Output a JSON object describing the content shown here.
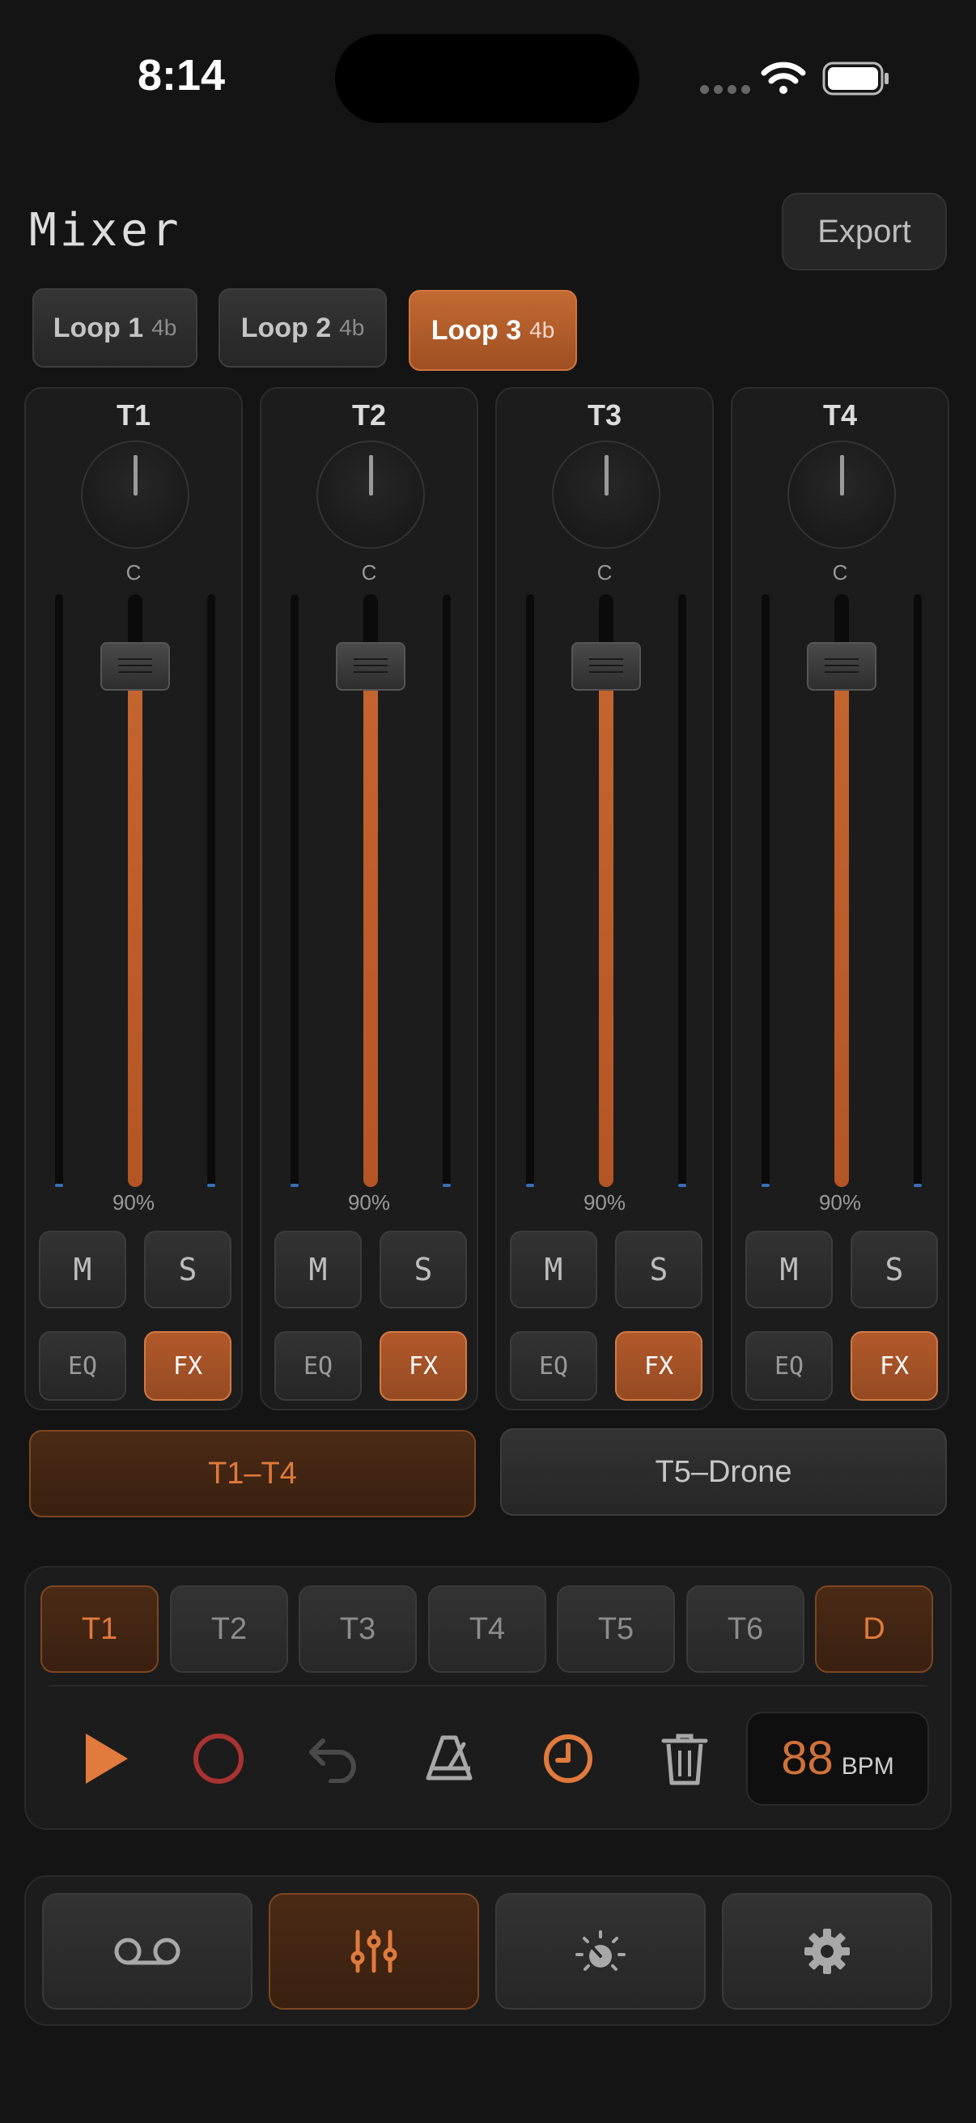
{
  "status": {
    "time": "8:14"
  },
  "header": {
    "title": "Mixer",
    "export_label": "Export"
  },
  "loops": [
    {
      "label": "Loop 1",
      "beats": "4b",
      "active": false
    },
    {
      "label": "Loop 2",
      "beats": "4b",
      "active": false
    },
    {
      "label": "Loop 3",
      "beats": "4b",
      "active": true
    }
  ],
  "channels": [
    {
      "name": "T1",
      "pan": "C",
      "volume_text": "90%",
      "volume": 0.9,
      "mute": "M",
      "solo": "S",
      "eq": "EQ",
      "fx": "FX"
    },
    {
      "name": "T2",
      "pan": "C",
      "volume_text": "90%",
      "volume": 0.9,
      "mute": "M",
      "solo": "S",
      "eq": "EQ",
      "fx": "FX"
    },
    {
      "name": "T3",
      "pan": "C",
      "volume_text": "90%",
      "volume": 0.9,
      "mute": "M",
      "solo": "S",
      "eq": "EQ",
      "fx": "FX"
    },
    {
      "name": "T4",
      "pan": "C",
      "volume_text": "90%",
      "volume": 0.9,
      "mute": "M",
      "solo": "S",
      "eq": "EQ",
      "fx": "FX"
    }
  ],
  "groups": [
    {
      "label": "T1–T4",
      "active": true
    },
    {
      "label": "T5–Drone",
      "active": false
    }
  ],
  "tracks": [
    "T1",
    "T2",
    "T3",
    "T4",
    "T5",
    "T6",
    "D"
  ],
  "transport": {
    "icons": [
      "play-icon",
      "record-icon",
      "undo-icon",
      "metronome-icon",
      "clock-icon",
      "trash-icon"
    ],
    "bpm_value": "88",
    "bpm_unit": "BPM"
  },
  "nav": [
    "tape-icon",
    "mixer-sliders-icon",
    "tuner-gauge-icon",
    "gear-icon"
  ],
  "colors": {
    "accent": "#c8662f",
    "background": "#141414",
    "record": "#a93232"
  }
}
